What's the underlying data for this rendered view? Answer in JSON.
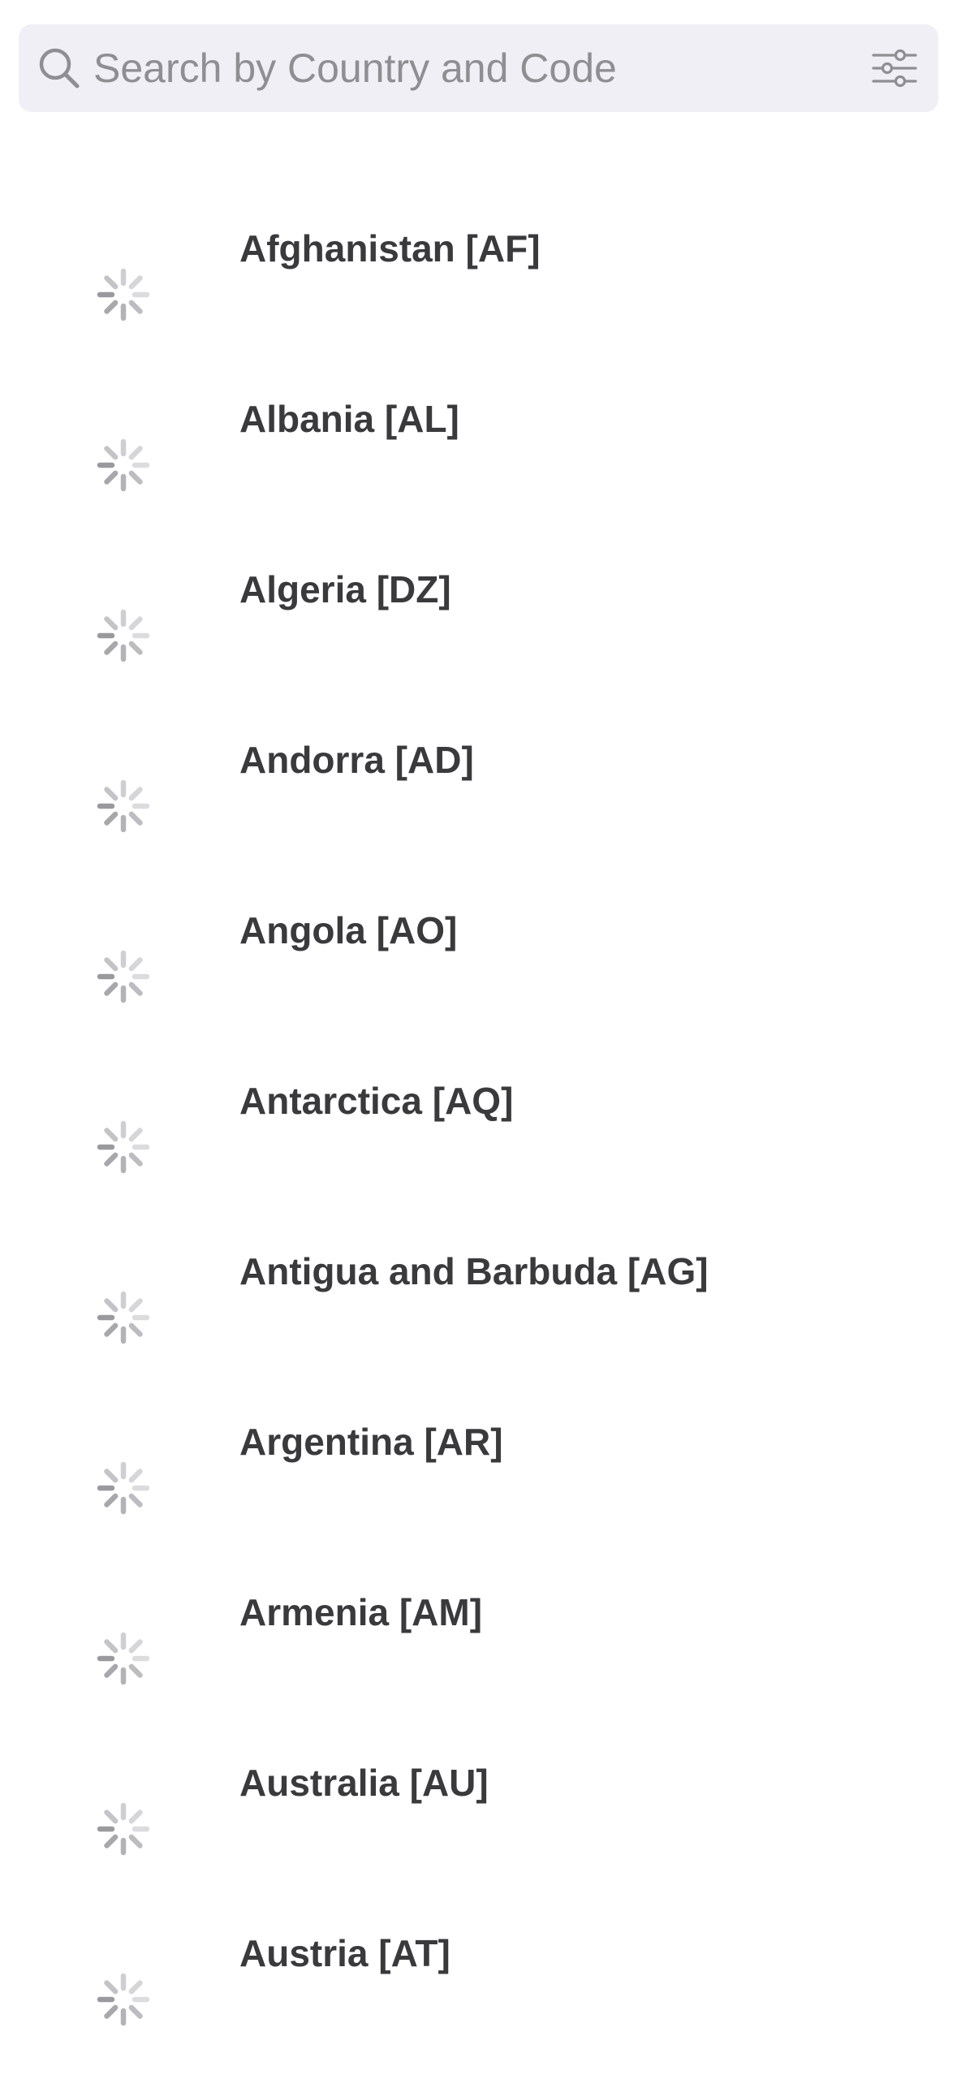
{
  "search": {
    "placeholder": "Search by Country and Code",
    "value": ""
  },
  "icons": {
    "search": "search-icon",
    "filter": "sliders-icon",
    "loading": "spinner-icon"
  },
  "countries": [
    {
      "label": "Afghanistan [AF]"
    },
    {
      "label": "Albania [AL]"
    },
    {
      "label": "Algeria [DZ]"
    },
    {
      "label": "Andorra [AD]"
    },
    {
      "label": "Angola [AO]"
    },
    {
      "label": "Antarctica [AQ]"
    },
    {
      "label": "Antigua and Barbuda [AG]"
    },
    {
      "label": "Argentina [AR]"
    },
    {
      "label": "Armenia [AM]"
    },
    {
      "label": "Australia [AU]"
    },
    {
      "label": "Austria [AT]"
    }
  ],
  "colors": {
    "search_bg": "#f0eff5",
    "placeholder": "#8e8e93",
    "text": "#3a3a3c",
    "spinner": "#9a9a9e"
  }
}
